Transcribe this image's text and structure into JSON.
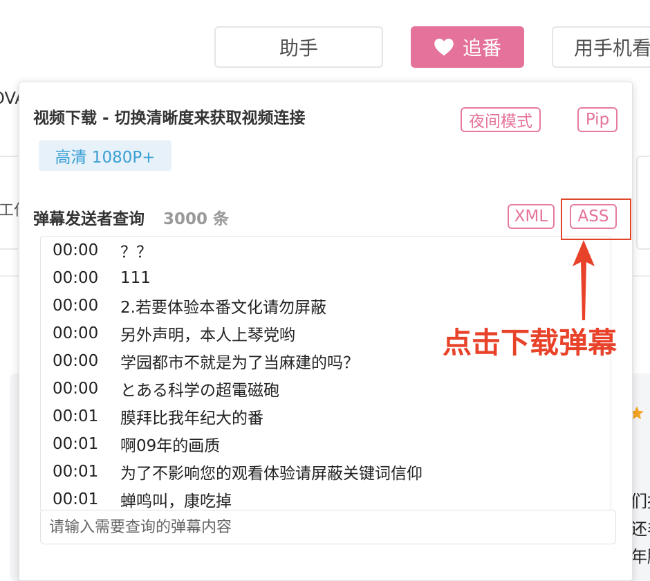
{
  "header": {
    "helper_label": "助手",
    "follow_label": "追番",
    "phone_label": "用手机看"
  },
  "background": {
    "fragment_ova": "OVA",
    "fragment_work": "工作",
    "right_lines": [
      "们报",
      "还非",
      "年脑"
    ]
  },
  "popup": {
    "video_title": "视频下载 - 切换清晰度来获取视频连接",
    "night_mode_label": "夜间模式",
    "pip_label": "Pip",
    "quality_label": "高清 1080P+",
    "danmaku_title": "弹幕发送者查询",
    "danmaku_count": "3000 条",
    "xml_label": "XML",
    "ass_label": "ASS",
    "danmaku_rows": [
      {
        "time": "00:00",
        "text": "？？"
      },
      {
        "time": "00:00",
        "text": "111"
      },
      {
        "time": "00:00",
        "text": "2.若要体验本番文化请勿屏蔽"
      },
      {
        "time": "00:00",
        "text": "另外声明，本人上琴党哟"
      },
      {
        "time": "00:00",
        "text": "学园都市不就是为了当麻建的吗？"
      },
      {
        "time": "00:00",
        "text": "とある科学の超電磁砲"
      },
      {
        "time": "00:01",
        "text": "膜拜比我年纪大的番"
      },
      {
        "time": "00:01",
        "text": "啊09年的画质"
      },
      {
        "time": "00:01",
        "text": "为了不影响您的观看体验请屏蔽关键词信仰"
      },
      {
        "time": "00:01",
        "text": "蝉鸣叫，康吃掉"
      }
    ],
    "search_placeholder": "请输入需要查询的弹幕内容"
  },
  "annotation": {
    "text": "点击下载弹幕"
  },
  "colors": {
    "accent_pink": "#e5729a",
    "quality_blue": "#3a9fd6",
    "annotation_red": "#e8422a"
  }
}
